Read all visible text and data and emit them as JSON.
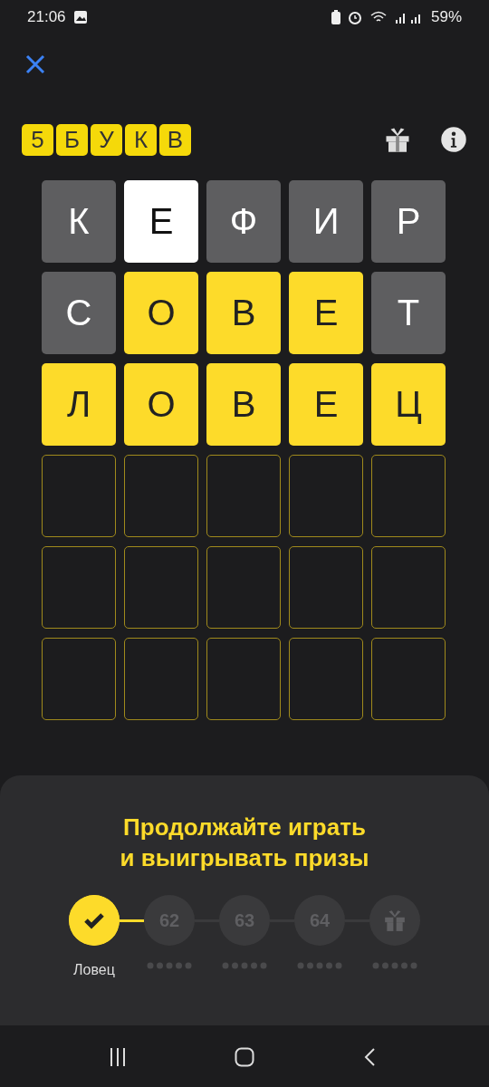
{
  "status_bar": {
    "time": "21:06",
    "battery": "59%"
  },
  "header": {
    "logo_letters": [
      "5",
      "Б",
      "У",
      "К",
      "В"
    ]
  },
  "board": {
    "rows": [
      [
        {
          "letter": "К",
          "kind": "absent"
        },
        {
          "letter": "Е",
          "kind": "present"
        },
        {
          "letter": "Ф",
          "kind": "absent"
        },
        {
          "letter": "И",
          "kind": "absent"
        },
        {
          "letter": "Р",
          "kind": "absent"
        }
      ],
      [
        {
          "letter": "С",
          "kind": "absent"
        },
        {
          "letter": "О",
          "kind": "correct"
        },
        {
          "letter": "В",
          "kind": "correct"
        },
        {
          "letter": "Е",
          "kind": "correct"
        },
        {
          "letter": "Т",
          "kind": "absent"
        }
      ],
      [
        {
          "letter": "Л",
          "kind": "correct"
        },
        {
          "letter": "О",
          "kind": "correct"
        },
        {
          "letter": "В",
          "kind": "correct"
        },
        {
          "letter": "Е",
          "kind": "correct"
        },
        {
          "letter": "Ц",
          "kind": "correct"
        }
      ],
      [
        {
          "kind": "empty"
        },
        {
          "kind": "empty"
        },
        {
          "kind": "empty"
        },
        {
          "kind": "empty"
        },
        {
          "kind": "empty"
        }
      ],
      [
        {
          "kind": "empty"
        },
        {
          "kind": "empty"
        },
        {
          "kind": "empty"
        },
        {
          "kind": "empty"
        },
        {
          "kind": "empty"
        }
      ],
      [
        {
          "kind": "empty"
        },
        {
          "kind": "empty"
        },
        {
          "kind": "empty"
        },
        {
          "kind": "empty"
        },
        {
          "kind": "empty"
        }
      ]
    ]
  },
  "panel": {
    "title_lines": [
      "Продолжайте играть",
      "и выигрывать призы"
    ],
    "steps": [
      {
        "kind": "done",
        "label": "Ловец"
      },
      {
        "kind": "number",
        "number": "62"
      },
      {
        "kind": "number",
        "number": "63"
      },
      {
        "kind": "number",
        "number": "64"
      },
      {
        "kind": "gift"
      }
    ]
  }
}
